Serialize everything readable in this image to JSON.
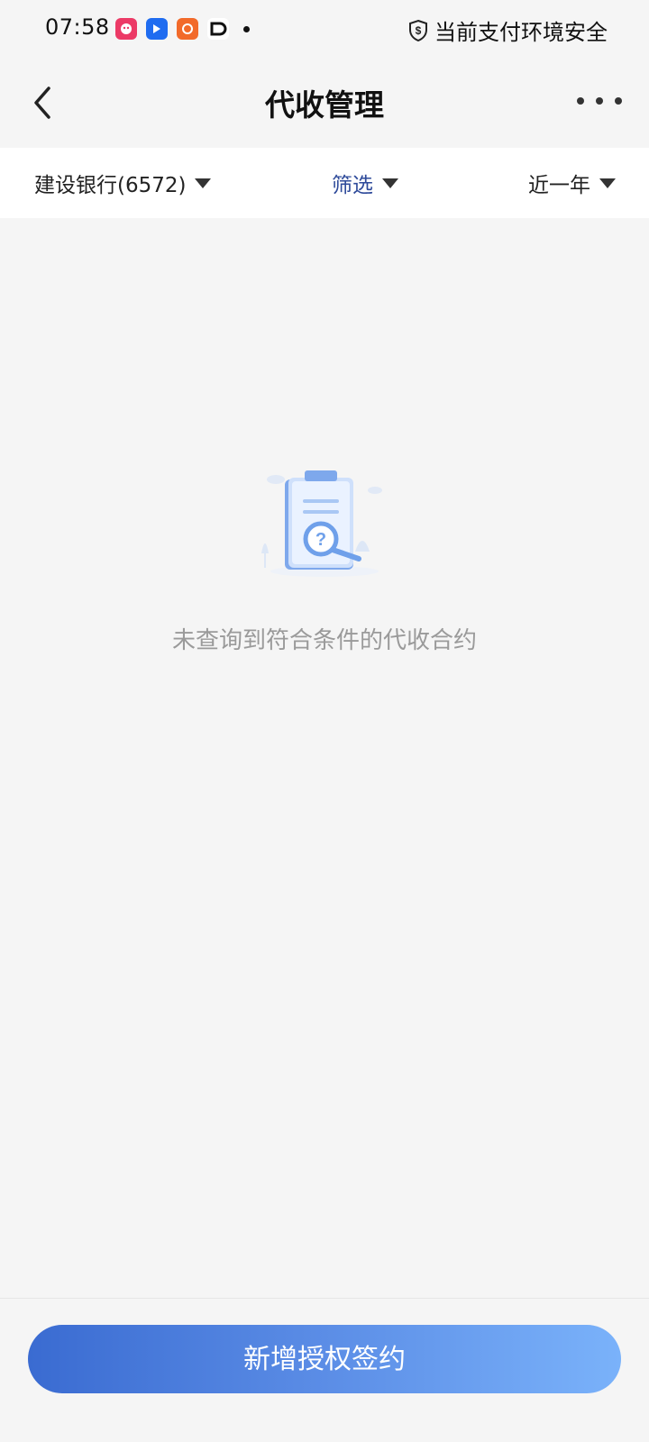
{
  "status_bar": {
    "time": "07:58",
    "app_icons": [
      "app-icon-pink",
      "app-icon-blue",
      "app-icon-orange",
      "app-icon-black"
    ],
    "security_text": "当前支付环境安全"
  },
  "nav": {
    "title": "代收管理"
  },
  "filters": {
    "bank": "建设银行(6572)",
    "filter": "筛选",
    "time_range": "近一年"
  },
  "empty_state": {
    "message": "未查询到符合条件的代收合约"
  },
  "footer": {
    "button_label": "新增授权签约"
  },
  "colors": {
    "accent_blue": "#2e4a9a",
    "button_gradient_start": "#3a6bd1",
    "button_gradient_end": "#7ab2fa",
    "background": "#f5f5f5"
  }
}
